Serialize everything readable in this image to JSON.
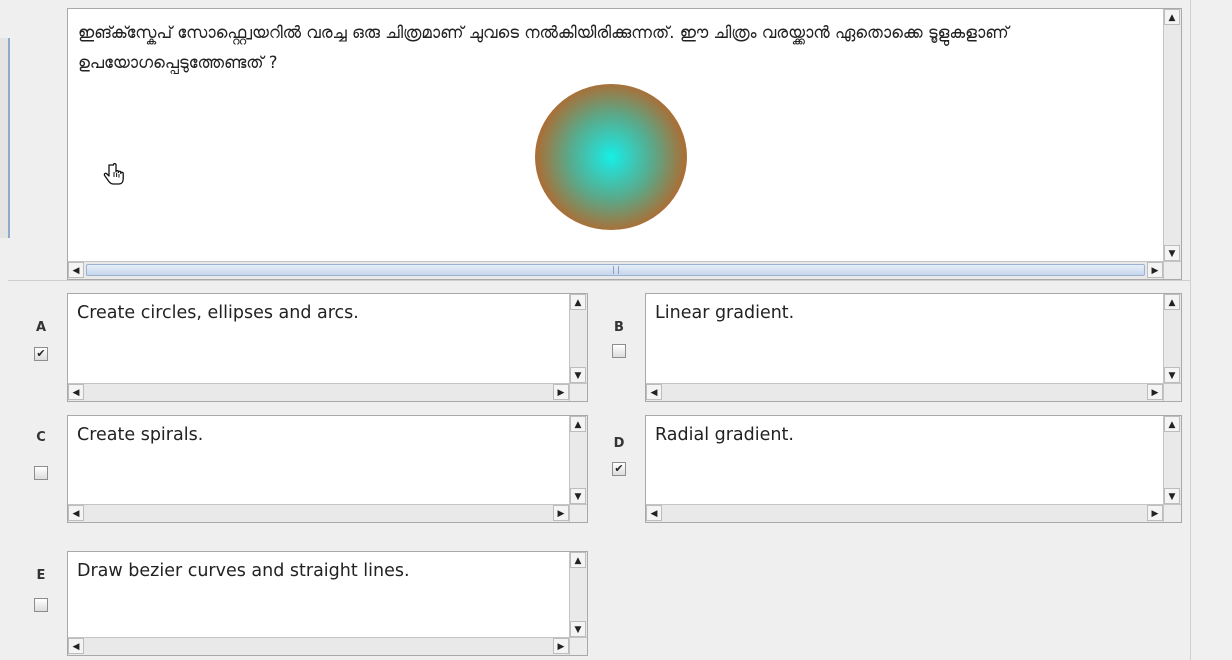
{
  "question": {
    "text": "ഇങ്ക്സ്കേപ് സോഫ്റ്റ്വെയറിൽ വരച്ച ഒരു ചിത്രമാണ് ചുവടെ നൽകിയിരിക്കുന്നത്. ഈ ചിത്രം വരയ്ക്കാൻ ഏതൊക്കെ ടൂളുകളാണ് ഉപയോഗപ്പെടുത്തേണ്ടത് ?",
    "image_icon": "radial-gradient-circle",
    "image_colors": {
      "center": "#14f0e6",
      "edge": "#c0651c"
    },
    "cursor_icon": "hand-pointer-icon"
  },
  "options": [
    {
      "letter": "A",
      "text": "Create circles, ellipses and arcs.",
      "checked": true
    },
    {
      "letter": "B",
      "text": "Linear gradient.",
      "checked": false
    },
    {
      "letter": "C",
      "text": "Create spirals.",
      "checked": false
    },
    {
      "letter": "D",
      "text": "Radial gradient.",
      "checked": true
    },
    {
      "letter": "E",
      "text": "Draw bezier curves and straight lines.",
      "checked": false
    }
  ],
  "glyphs": {
    "up": "▲",
    "down": "▼",
    "left": "◀",
    "right": "▶",
    "check": "✔"
  },
  "colors": {
    "scroll_thumb": "#c6d6ec",
    "window_bg": "#efefef"
  }
}
